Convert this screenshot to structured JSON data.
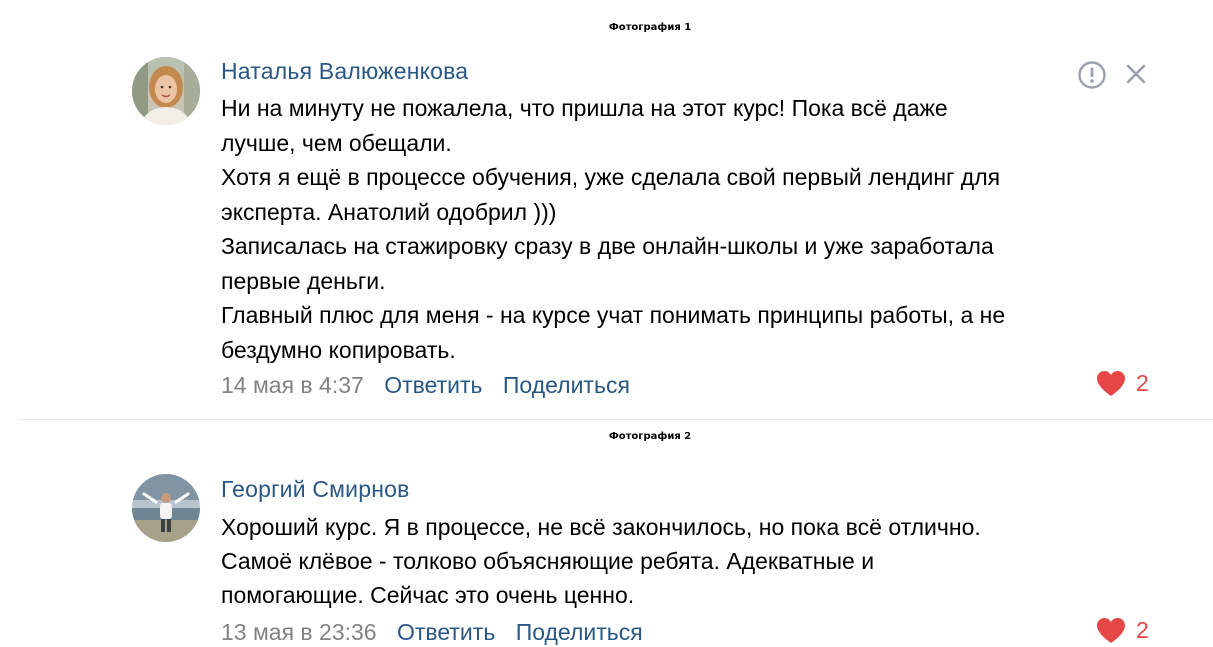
{
  "captions": {
    "photo1": "Фотография 1",
    "photo2": "Фотография 2"
  },
  "comments": [
    {
      "author": "Наталья Валюженкова",
      "lines": [
        "Ни на минуту не пожалела, что пришла на этот курс! Пока всё даже",
        "лучше, чем обещали.",
        "Хотя я ещё в процессе обучения, уже сделала свой первый лендинг для",
        "эксперта. Анатолий одобрил )))",
        "Записалась на стажировку сразу в две онлайн-школы и уже заработала",
        "первые деньги.",
        "Главный плюс для меня - на курсе учат понимать принципы работы, а не",
        "бездумно копировать."
      ],
      "date": "14 мая в 4:37",
      "reply_label": "Ответить",
      "share_label": "Поделиться",
      "likes": "2"
    },
    {
      "author": "Георгий Смирнов",
      "lines": [
        "Хороший курс. Я в процессе, не всё закончилось, но пока всё отлично.",
        "Самоё клёвое - толково объясняющие ребята. Адекватные и",
        "помогающие. Сейчас это очень ценно."
      ],
      "date": "13 мая в 23:36",
      "reply_label": "Ответить",
      "share_label": "Поделиться",
      "likes": "2"
    }
  ],
  "icons": {
    "report": "report-icon",
    "close": "close-icon",
    "like": "heart-icon"
  },
  "colors": {
    "link": "#2a5885",
    "meta": "#828282",
    "like": "#e64646",
    "divider": "#e7e8ec"
  }
}
